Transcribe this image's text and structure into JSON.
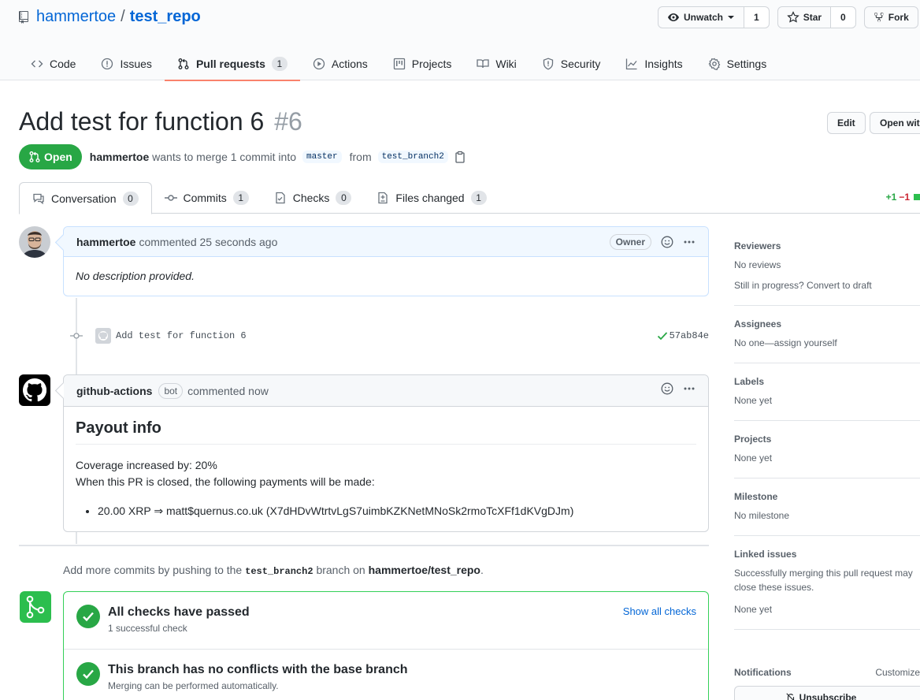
{
  "repo": {
    "owner": "hammertoe",
    "separator": "/",
    "name": "test_repo"
  },
  "header_actions": {
    "watch_label": "Unwatch",
    "watch_count": "1",
    "star_label": "Star",
    "star_count": "0",
    "fork_label": "Fork"
  },
  "repo_nav": [
    {
      "label": "Code",
      "icon": "code-icon"
    },
    {
      "label": "Issues",
      "icon": "issue-icon"
    },
    {
      "label": "Pull requests",
      "icon": "pull-request-icon",
      "count": "1",
      "selected": true
    },
    {
      "label": "Actions",
      "icon": "play-icon"
    },
    {
      "label": "Projects",
      "icon": "project-icon"
    },
    {
      "label": "Wiki",
      "icon": "book-icon"
    },
    {
      "label": "Security",
      "icon": "shield-icon"
    },
    {
      "label": "Insights",
      "icon": "graph-icon"
    },
    {
      "label": "Settings",
      "icon": "gear-icon"
    }
  ],
  "pr": {
    "title": "Add test for function 6",
    "number": "#6",
    "edit_label": "Edit",
    "open_with_label": "Open with",
    "state": "Open",
    "author": "hammertoe",
    "merge_text": "wants to merge 1 commit into",
    "base_branch": "master",
    "from_text": "from",
    "head_branch": "test_branch2"
  },
  "pr_tabs": [
    {
      "label": "Conversation",
      "count": "0",
      "icon": "comment-icon",
      "selected": true
    },
    {
      "label": "Commits",
      "count": "1",
      "icon": "commit-icon"
    },
    {
      "label": "Checks",
      "count": "0",
      "icon": "checklist-icon"
    },
    {
      "label": "Files changed",
      "count": "1",
      "icon": "file-diff-icon"
    }
  ],
  "diffstat": {
    "additions": "+1",
    "deletions": "−1"
  },
  "comment1": {
    "author": "hammertoe",
    "meta": "commented 25 seconds ago",
    "badge": "Owner",
    "body": "No description provided."
  },
  "commit": {
    "message": "Add test for function 6",
    "sha": "57ab84e"
  },
  "comment2": {
    "author": "github-actions",
    "badge": "bot",
    "meta": "commented now",
    "heading": "Payout info",
    "line1": "Coverage increased by: 20%",
    "line2": "When this PR is closed, the following payments will be made:",
    "payment": "20.00 XRP ⇒ matt$quernus.co.uk (X7dHDvWtrtvLgS7uimbKZKNetMNoSk2rmoTcXFf1dKVgDJm)"
  },
  "push_note": {
    "prefix": "Add more commits by pushing to the",
    "branch": "test_branch2",
    "middle": "branch on",
    "repo": "hammertoe/test_repo",
    "suffix": "."
  },
  "merge": {
    "checks_title": "All checks have passed",
    "checks_sub": "1 successful check",
    "show_all": "Show all checks",
    "conflict_title": "This branch has no conflicts with the base branch",
    "conflict_sub": "Merging can be performed automatically."
  },
  "sidebar": {
    "reviewers_title": "Reviewers",
    "reviewers_value": "No reviews",
    "reviewers_hint": "Still in progress? Convert to draft",
    "assignees_title": "Assignees",
    "assignees_value": "No one—assign yourself",
    "labels_title": "Labels",
    "labels_value": "None yet",
    "projects_title": "Projects",
    "projects_value": "None yet",
    "milestone_title": "Milestone",
    "milestone_value": "No milestone",
    "linked_title": "Linked issues",
    "linked_line1": "Successfully merging this pull request may",
    "linked_line2": "close these issues.",
    "linked_value": "None yet",
    "notifications_title": "Notifications",
    "notifications_customize": "Customize",
    "unsubscribe_label": "Unsubscribe"
  },
  "colors": {
    "accent": "#0366d6",
    "open_green": "#28a745",
    "nav_underline": "#f9826c"
  }
}
